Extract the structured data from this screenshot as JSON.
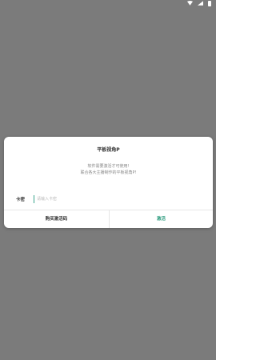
{
  "colors": {
    "backdrop": "#7b7b7b",
    "accent": "#2a9a7c",
    "dialog_bg": "#ffffff"
  },
  "status_bar": {
    "icons": [
      "wifi-icon",
      "signal-icon",
      "battery-icon"
    ]
  },
  "dialog": {
    "title": "平板视角P",
    "message_line1": "软件需要激活才可使用!",
    "message_line2": "联合各大主播制作的平板视角P!",
    "card_label": "卡密",
    "card_placeholder": "请输入卡密",
    "card_value": "",
    "buy_button": "购买激活码",
    "activate_button": "激活"
  }
}
